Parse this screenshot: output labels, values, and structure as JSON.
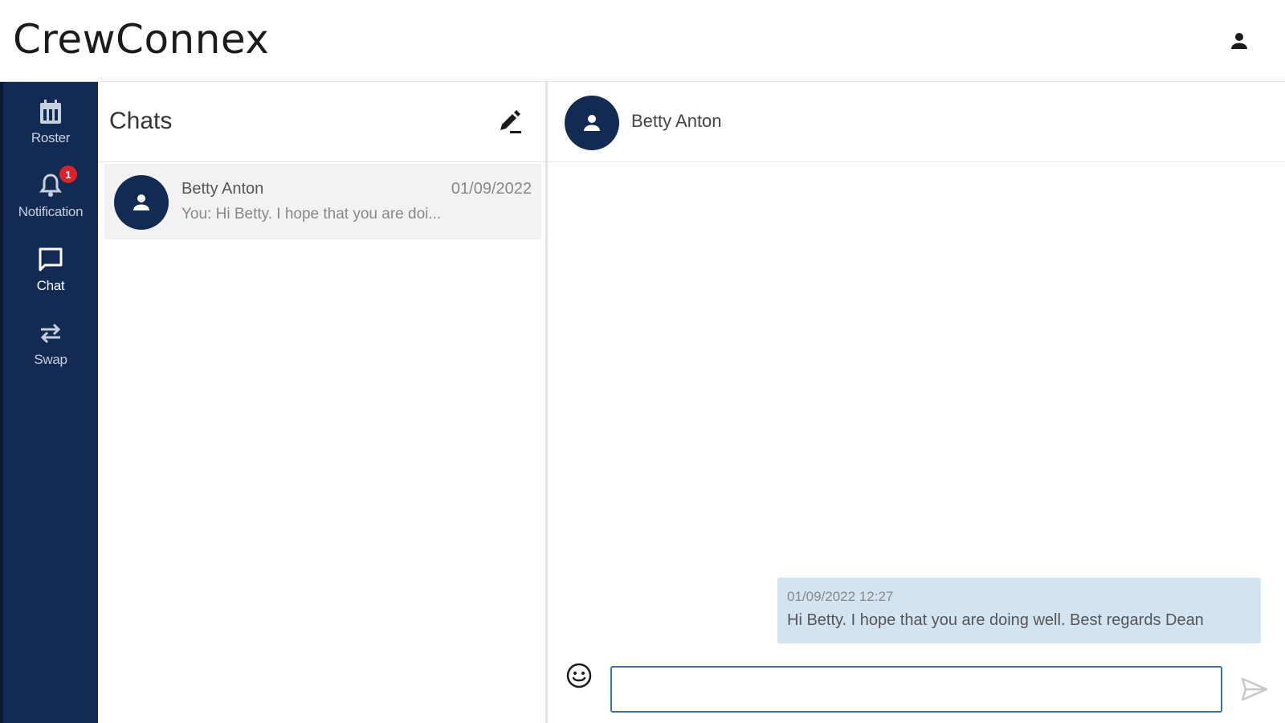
{
  "app": {
    "title": "CrewConnex"
  },
  "colors": {
    "sidebar": "#132a52",
    "accent": "#3b6fa8",
    "badge": "#d8232a",
    "bubble": "#d3e3f0",
    "selected_row": "#f2f2f2"
  },
  "sidebar": {
    "items": [
      {
        "label": "Roster",
        "icon": "calendar-icon"
      },
      {
        "label": "Notification",
        "icon": "bell-icon",
        "badge": "1"
      },
      {
        "label": "Chat",
        "icon": "chat-bubble-icon",
        "active": true
      },
      {
        "label": "Swap",
        "icon": "swap-arrows-icon"
      }
    ]
  },
  "chat_list": {
    "title": "Chats",
    "conversations": [
      {
        "name": "Betty Anton",
        "date": "01/09/2022",
        "preview": "You: Hi Betty. I hope that you are doi..."
      }
    ]
  },
  "conversation": {
    "contact_name": "Betty Anton",
    "messages": [
      {
        "timestamp": "01/09/2022 12:27",
        "text": "Hi Betty. I hope that you are doing well. Best regards Dean"
      }
    ],
    "input": {
      "value": "",
      "placeholder": ""
    }
  }
}
